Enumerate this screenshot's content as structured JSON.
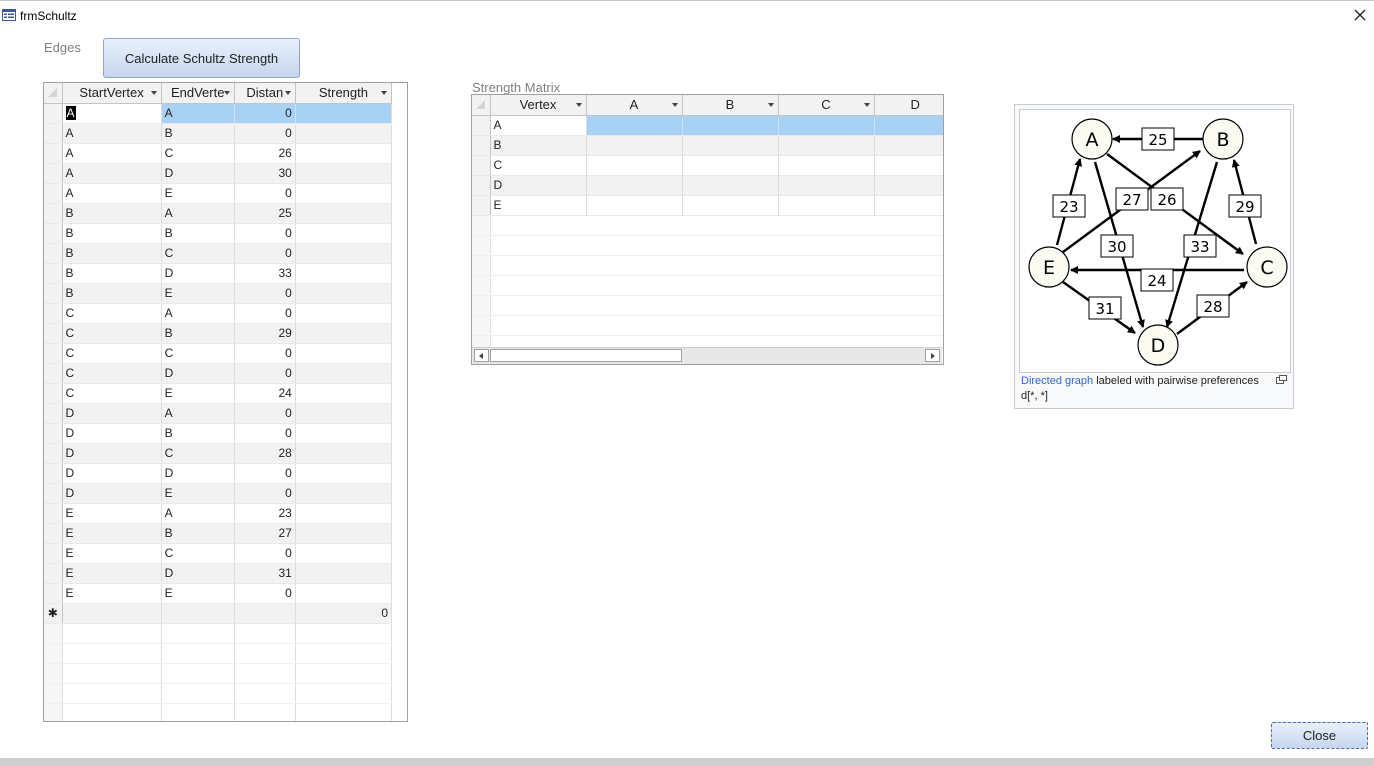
{
  "window": {
    "title": "frmSchultz",
    "close_label": "×"
  },
  "edges": {
    "label": "Edges",
    "columns": [
      "StartVertex",
      "EndVerte",
      "Distan",
      "Strength"
    ],
    "rows": [
      [
        "A",
        "A",
        "0",
        ""
      ],
      [
        "A",
        "B",
        "0",
        ""
      ],
      [
        "A",
        "C",
        "26",
        ""
      ],
      [
        "A",
        "D",
        "30",
        ""
      ],
      [
        "A",
        "E",
        "0",
        ""
      ],
      [
        "B",
        "A",
        "25",
        ""
      ],
      [
        "B",
        "B",
        "0",
        ""
      ],
      [
        "B",
        "C",
        "0",
        ""
      ],
      [
        "B",
        "D",
        "33",
        ""
      ],
      [
        "B",
        "E",
        "0",
        ""
      ],
      [
        "C",
        "A",
        "0",
        ""
      ],
      [
        "C",
        "B",
        "29",
        ""
      ],
      [
        "C",
        "C",
        "0",
        ""
      ],
      [
        "C",
        "D",
        "0",
        ""
      ],
      [
        "C",
        "E",
        "24",
        ""
      ],
      [
        "D",
        "A",
        "0",
        ""
      ],
      [
        "D",
        "B",
        "0",
        ""
      ],
      [
        "D",
        "C",
        "28",
        ""
      ],
      [
        "D",
        "D",
        "0",
        ""
      ],
      [
        "D",
        "E",
        "0",
        ""
      ],
      [
        "E",
        "A",
        "23",
        ""
      ],
      [
        "E",
        "B",
        "27",
        ""
      ],
      [
        "E",
        "C",
        "0",
        ""
      ],
      [
        "E",
        "D",
        "31",
        ""
      ],
      [
        "E",
        "E",
        "0",
        ""
      ]
    ],
    "new_row_marker": "✱",
    "new_row_strength": "0"
  },
  "toolbar": {
    "calculate_label": "Calculate Schultz Strength"
  },
  "matrix": {
    "label": "Strength Matrix",
    "columns": [
      "Vertex",
      "A",
      "B",
      "C",
      "D"
    ],
    "rows": [
      "A",
      "B",
      "C",
      "D",
      "E"
    ]
  },
  "figure": {
    "nodes": [
      "A",
      "B",
      "C",
      "D",
      "E"
    ],
    "edge_labels": [
      "25",
      "23",
      "27",
      "26",
      "29",
      "30",
      "33",
      "24",
      "31",
      "28"
    ],
    "caption_link": "Directed graph",
    "caption_text": " labeled with pairwise preferences d[*, *]"
  },
  "footer": {
    "close_label": "Close"
  }
}
